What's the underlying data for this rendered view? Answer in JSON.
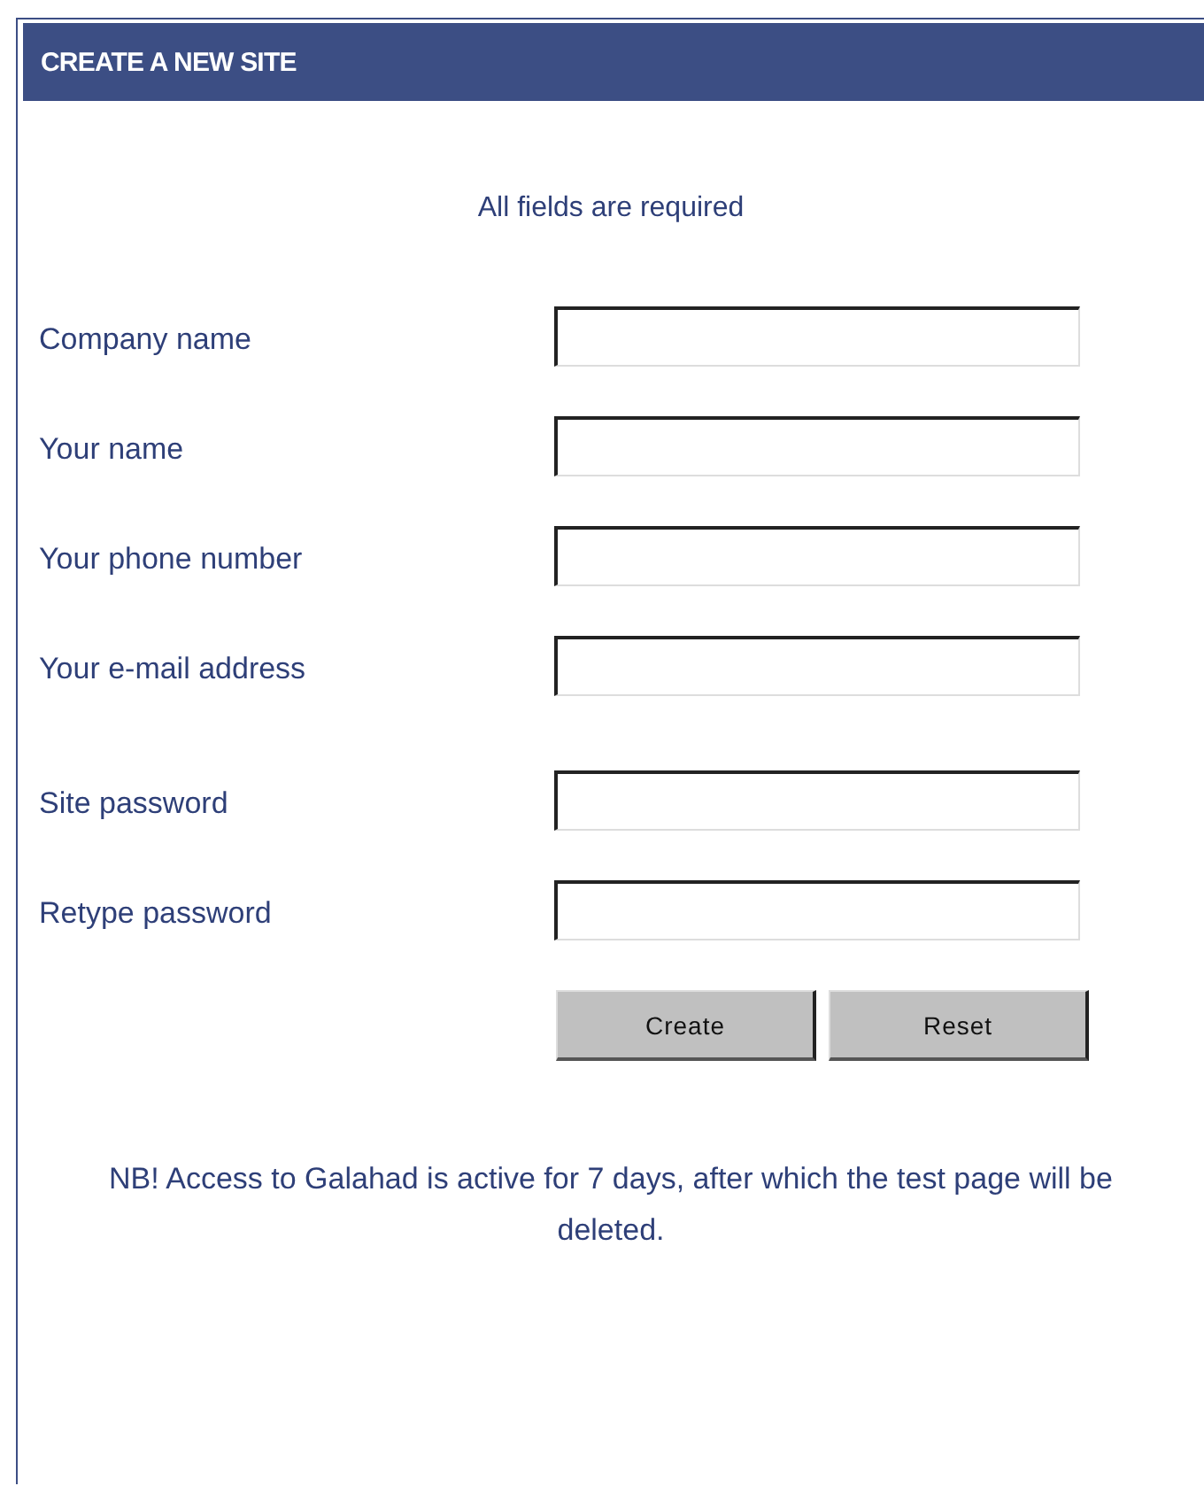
{
  "panel": {
    "title": "CREATE A NEW SITE"
  },
  "note": "All fields are required",
  "field_groups": [
    [
      {
        "label": "Company name"
      },
      {
        "label": "Your name"
      },
      {
        "label": "Your phone number"
      },
      {
        "label": "Your e-mail address"
      }
    ],
    [
      {
        "label": "Site password"
      },
      {
        "label": "Retype password"
      }
    ]
  ],
  "buttons": [
    "Create",
    "Reset"
  ],
  "footer_note": "NB! Access to Galahad is active for 7 days, after which the test page will be deleted."
}
